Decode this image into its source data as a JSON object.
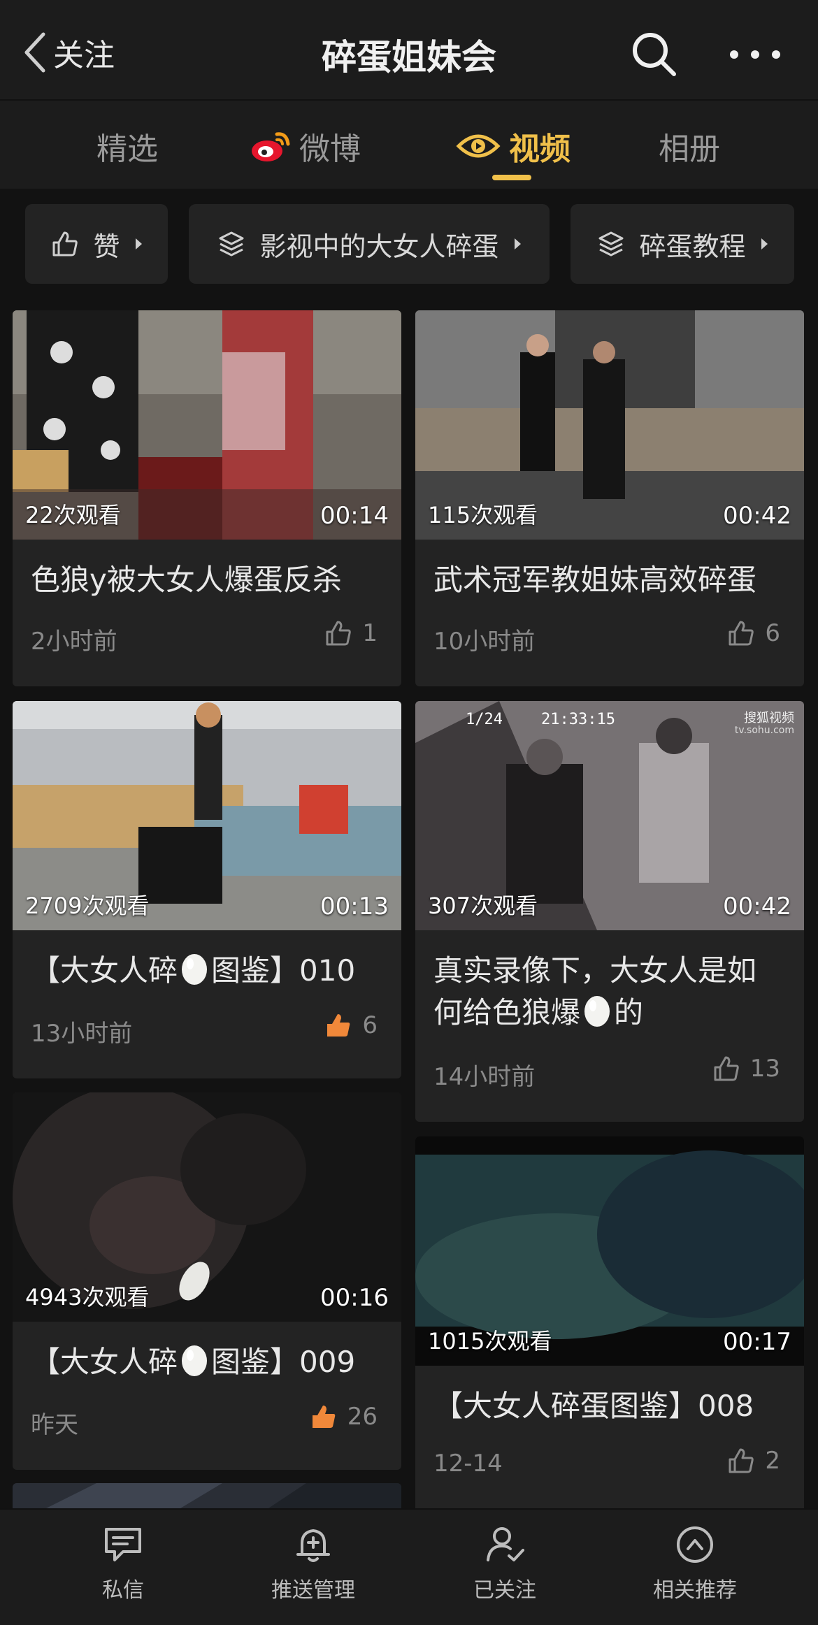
{
  "header": {
    "back_label": "关注",
    "title": "碎蛋姐妹会"
  },
  "tabs": [
    {
      "label": "精选"
    },
    {
      "label": "微博"
    },
    {
      "label": "视频"
    },
    {
      "label": "相册"
    }
  ],
  "active_tab": "视频",
  "filters": [
    {
      "label": "赞",
      "icon": "thumb-up-icon"
    },
    {
      "label": "影视中的大女人碎蛋",
      "icon": "layers-icon"
    },
    {
      "label": "碎蛋教程",
      "icon": "layers-icon"
    }
  ],
  "videos": [
    {
      "views": "22次观看",
      "duration": "00:14",
      "title": "色狼y被大女人爆蛋反杀",
      "time": "2小时前",
      "likes": "1"
    },
    {
      "views": "115次观看",
      "duration": "00:42",
      "title": "武术冠军教姐妹高效碎蛋",
      "time": "10小时前",
      "likes": "6"
    },
    {
      "views": "2709次观看",
      "duration": "00:13",
      "title_before": "【大女人碎",
      "title_after": "图鉴】010",
      "time": "13小时前",
      "likes": "6"
    },
    {
      "views": "307次观看",
      "duration": "00:42",
      "title_line1": "真实录像下，大女人是如",
      "title_before": "何给色狼爆",
      "title_after": "的",
      "time": "14小时前",
      "likes": "13",
      "overlay_date": "1/24",
      "overlay_clock": "21:33:15",
      "overlay_source": "搜狐视频",
      "overlay_url": "tv.sohu.com"
    },
    {
      "views": "4943次观看",
      "duration": "00:16",
      "title_before": "【大女人碎",
      "title_after": "图鉴】009",
      "time": "昨天",
      "likes": "26"
    },
    {
      "views": "1015次观看",
      "duration": "00:17",
      "title": "【大女人碎蛋图鉴】008",
      "time": "12-14",
      "likes": "2"
    }
  ],
  "bottom_bar": [
    {
      "label": "私信",
      "icon": "message-icon"
    },
    {
      "label": "推送管理",
      "icon": "bell-plus-icon"
    },
    {
      "label": "已关注",
      "icon": "user-check-icon"
    },
    {
      "label": "相关推荐",
      "icon": "chevron-up-circle-icon"
    }
  ],
  "colors": {
    "accent": "#f0c04a",
    "liked": "#f0883a",
    "background": "#121212",
    "card": "#232323"
  }
}
